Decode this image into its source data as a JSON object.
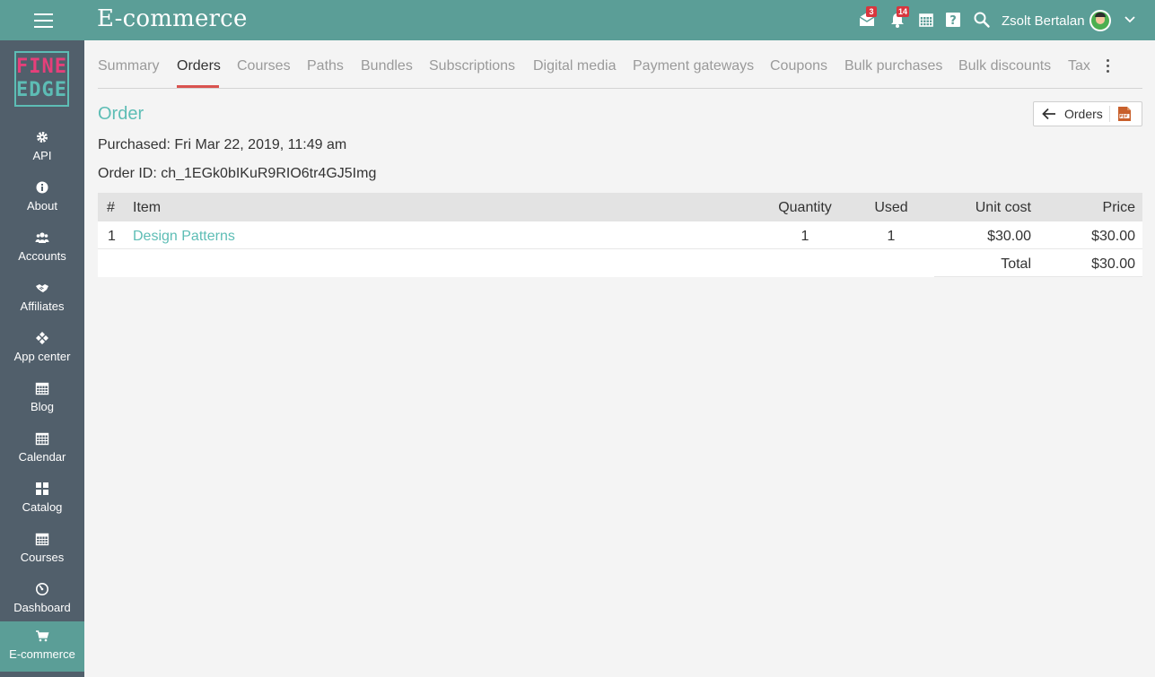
{
  "app": {
    "title": "E-commerce"
  },
  "topbar": {
    "messages_badge": "3",
    "notifications_badge": "14",
    "user_name": "Zsolt Bertalan"
  },
  "logo": {
    "line1": "FINE",
    "line2": "EDGE"
  },
  "sidebar": {
    "items": [
      {
        "label": "API",
        "icon": "gear-icon"
      },
      {
        "label": "About",
        "icon": "info-icon"
      },
      {
        "label": "Accounts",
        "icon": "users-icon"
      },
      {
        "label": "Affiliates",
        "icon": "handshake-icon"
      },
      {
        "label": "App center",
        "icon": "apps-icon"
      },
      {
        "label": "Blog",
        "icon": "calendar-icon"
      },
      {
        "label": "Calendar",
        "icon": "grid-calendar-icon"
      },
      {
        "label": "Catalog",
        "icon": "catalog-grid-icon"
      },
      {
        "label": "Courses",
        "icon": "calendar-icon"
      },
      {
        "label": "Dashboard",
        "icon": "dashboard-gauge-icon"
      },
      {
        "label": "E-commerce",
        "icon": "cart-icon"
      }
    ],
    "active": "E-commerce"
  },
  "tabs": [
    {
      "label": "Summary"
    },
    {
      "label": "Orders"
    },
    {
      "label": "Courses"
    },
    {
      "label": "Paths"
    },
    {
      "label": "Bundles"
    },
    {
      "label": "Subscriptions"
    },
    {
      "label": "Digital media"
    },
    {
      "label": "Payment gateways"
    },
    {
      "label": "Coupons"
    },
    {
      "label": "Bulk purchases"
    },
    {
      "label": "Bulk discounts"
    },
    {
      "label": "Tax"
    }
  ],
  "active_tab": "Orders",
  "order": {
    "title": "Order",
    "back_label": "Orders",
    "purchased": "Purchased: Fri Mar 22, 2019, 11:49 am",
    "order_id": "Order ID: ch_1EGk0bIKuR9RIO6tr4GJ5Img"
  },
  "table": {
    "headers": {
      "num": "#",
      "item": "Item",
      "quantity": "Quantity",
      "used": "Used",
      "unit_cost": "Unit cost",
      "price": "Price"
    },
    "rows": [
      {
        "num": "1",
        "item": "Design Patterns",
        "quantity": "1",
        "used": "1",
        "unit_cost": "$30.00",
        "price": "$30.00"
      }
    ],
    "total_label": "Total",
    "total_value": "$30.00"
  },
  "colors": {
    "topbar": "#5b9e97",
    "sidebar": "#515f6b",
    "accent": "#5dbdb5",
    "tab_underline": "#d9534f",
    "badge": "#d9363e",
    "logo_pink": "#e63f7a"
  }
}
